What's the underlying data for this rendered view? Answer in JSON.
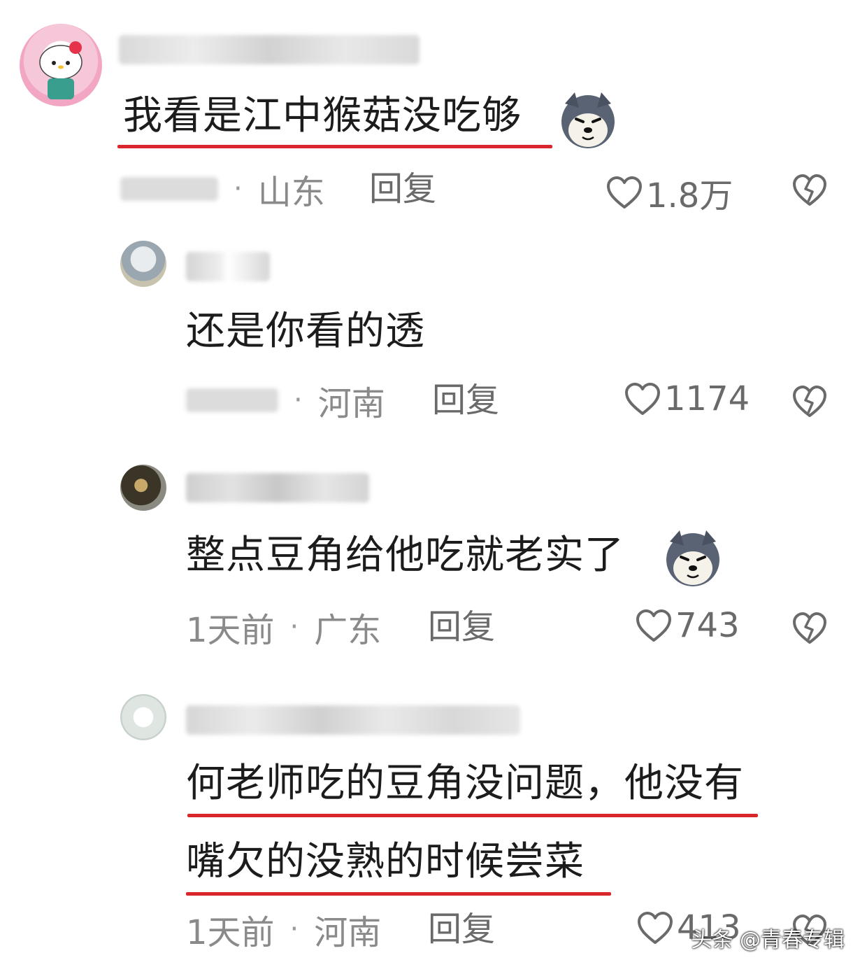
{
  "comments": [
    {
      "text": "我看是江中猴菇没吃够",
      "location": "山东",
      "reply_label": "回复",
      "likes": "1.8万",
      "has_emoji": true,
      "underlined": true
    },
    {
      "text": "还是你看的透",
      "location": "河南",
      "reply_label": "回复",
      "likes": "1174",
      "has_emoji": false,
      "underlined": false
    },
    {
      "text": "整点豆角给他吃就老实了",
      "time": "1天前",
      "location": "广东",
      "reply_label": "回复",
      "likes": "743",
      "has_emoji": true,
      "underlined": false
    },
    {
      "text_line1": "何老师吃的豆角没问题，他没有",
      "text_line2": "嘴欠的没熟的时候尝菜",
      "time": "1天前",
      "location": "河南",
      "reply_label": "回复",
      "likes": "413",
      "has_emoji": false,
      "underlined": true
    }
  ],
  "watermark": "头条 @青春专辑",
  "colors": {
    "underline": "#d9262b",
    "meta_text": "#8a8a8a",
    "body_text": "#1c1c1c"
  },
  "icons": {
    "like": "heart-outline-icon",
    "dislike": "broken-heart-icon",
    "emoji": "husky-dog-emoji"
  }
}
